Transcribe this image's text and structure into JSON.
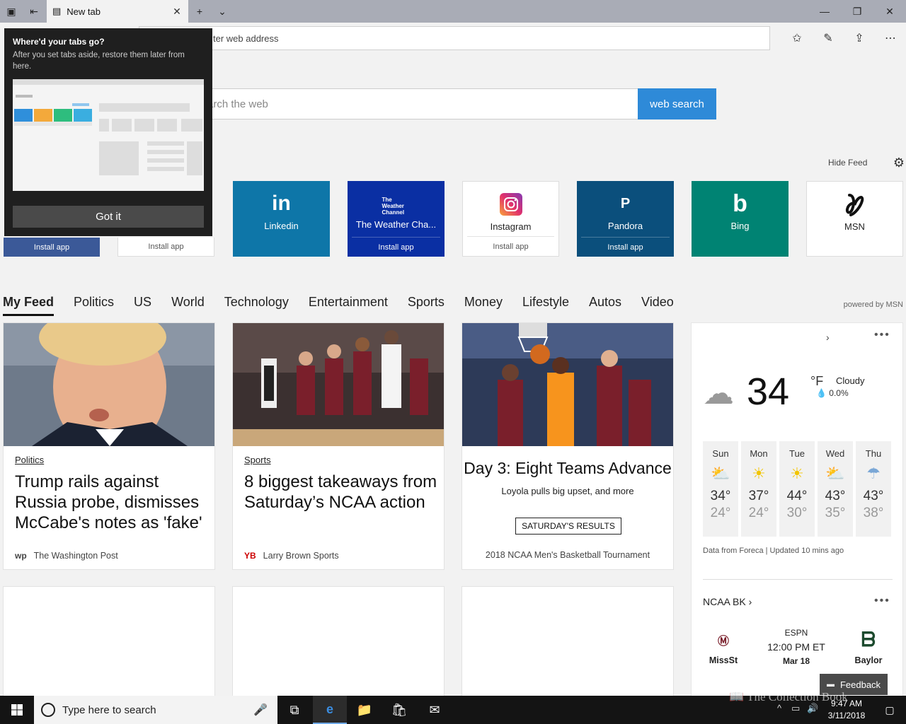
{
  "tab": {
    "title": "New tab"
  },
  "address": {
    "placeholder": "Search or enter web address",
    "visible_text": "ter web address"
  },
  "search": {
    "placeholder": "Search the web",
    "visible_text": "arch the web",
    "button_label": "web search"
  },
  "hide_feed": {
    "label": "Hide Feed"
  },
  "callout": {
    "title": "Where'd your tabs go?",
    "body": "After you set tabs aside, restore them later from here.",
    "button_label": "Got it"
  },
  "tiles": [
    {
      "name": "",
      "install_label": "Install app",
      "bg": "#3b5998",
      "partial": true
    },
    {
      "name": "",
      "install_label": "Install app",
      "bg": "#ffffff",
      "partial": true
    },
    {
      "name": "Linkedin",
      "install_label": "",
      "bg": "#0e76a8",
      "logo": "in"
    },
    {
      "name": "The Weather Cha...",
      "install_label": "Install app",
      "bg": "#0a2fa3",
      "logo": "The Weather Channel"
    },
    {
      "name": "Instagram",
      "install_label": "Install app",
      "bg": "#ffffff",
      "logo": "instagram-icon"
    },
    {
      "name": "Pandora",
      "install_label": "Install app",
      "bg": "#0b4f7c",
      "logo": "P"
    },
    {
      "name": "Bing",
      "install_label": "",
      "bg": "#008373",
      "logo": "b"
    },
    {
      "name": "MSN",
      "install_label": "",
      "bg": "#ffffff",
      "logo": "msn-icon"
    }
  ],
  "feed_nav": {
    "categories": [
      "My Feed",
      "Politics",
      "US",
      "World",
      "Technology",
      "Entertainment",
      "Sports",
      "Money",
      "Lifestyle",
      "Autos",
      "Video"
    ],
    "active": "My Feed",
    "powered_by": "powered by MSN"
  },
  "cards": [
    {
      "category": "Politics",
      "headline": "Trump rails against Russia probe, dismisses McCabe's notes as 'fake'",
      "source": "The Washington Post",
      "source_icon": "wp"
    },
    {
      "category": "Sports",
      "headline": "8 biggest takeaways from Saturday’s NCAA action",
      "source": "Larry Brown Sports",
      "source_icon": "YB"
    },
    {
      "headline": "Day 3: Eight Teams Advance",
      "subhead": "Loyola pulls big upset, and more",
      "button_label": "SATURDAY'S RESULTS",
      "footer": "2018 NCAA Men's Basketball Tournament"
    }
  ],
  "weather": {
    "temp": "34",
    "unit": "°F",
    "condition": "Cloudy",
    "precip": "0.0%",
    "forecast": [
      {
        "day": "Sun",
        "icon": "partly-sunny-icon",
        "hi": "34°",
        "lo": "24°"
      },
      {
        "day": "Mon",
        "icon": "sunny-icon",
        "hi": "37°",
        "lo": "24°"
      },
      {
        "day": "Tue",
        "icon": "sunny-icon",
        "hi": "44°",
        "lo": "30°"
      },
      {
        "day": "Wed",
        "icon": "partly-sunny-icon",
        "hi": "43°",
        "lo": "35°"
      },
      {
        "day": "Thu",
        "icon": "rain-icon",
        "hi": "43°",
        "lo": "38°"
      }
    ],
    "data_source": "Data from Foreca | Updated 10 mins ago"
  },
  "ncaa": {
    "title": "NCAA BK",
    "home_team": "MissSt",
    "away_team": "Baylor",
    "network": "ESPN",
    "time": "12:00 PM ET",
    "date": "Mar 18"
  },
  "feedback_label": "Feedback",
  "taskbar": {
    "search_placeholder": "Type here to search",
    "time": "9:47 AM",
    "date": "3/11/2018"
  },
  "watermark": "The Collection Book"
}
